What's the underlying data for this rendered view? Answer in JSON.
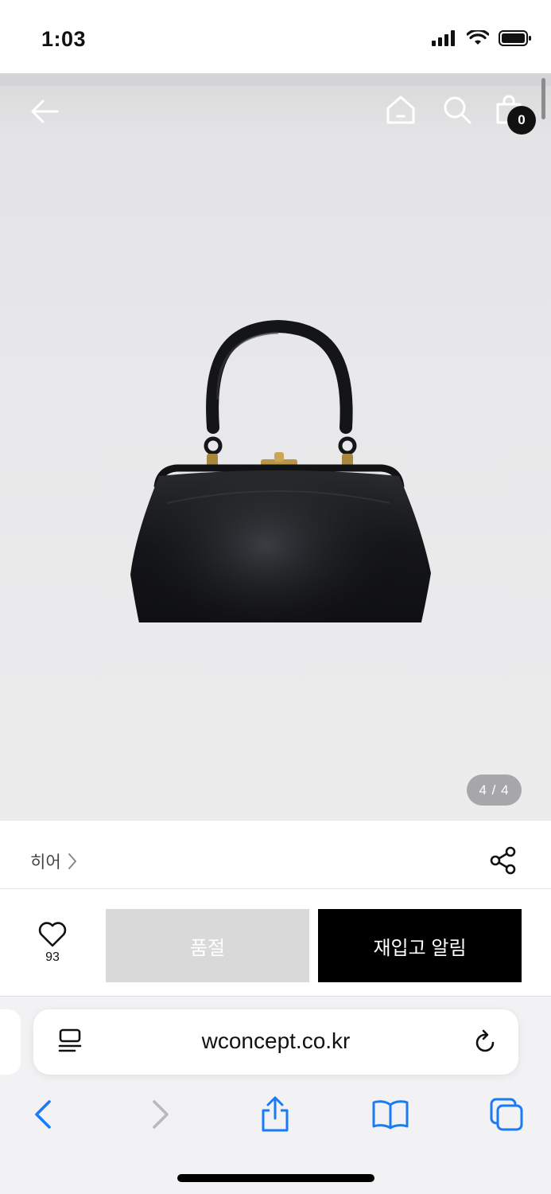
{
  "status_bar": {
    "time": "1:03"
  },
  "product": {
    "image_counter": "4 / 4",
    "cart_count": "0",
    "brand": "히어",
    "like_count": "93",
    "soldout_label": "품절",
    "restock_label": "재입고 알림"
  },
  "browser": {
    "url": "wconcept.co.kr"
  },
  "icons": {
    "back": "arrow-left-icon",
    "home": "home-icon",
    "search": "search-icon",
    "cart": "shopping-bag-icon",
    "share": "share-icon",
    "wish": "heart-icon",
    "reader": "reader-icon",
    "reload": "reload-icon",
    "nav_back": "chevron-left-icon",
    "nav_forward": "chevron-right-icon",
    "share_sheet": "share-sheet-icon",
    "bookmarks": "book-icon",
    "tabs": "tabs-icon"
  },
  "colors": {
    "accent_blue": "#1a7cf5",
    "button_black": "#000000",
    "button_disabled": "#d9d9d9"
  }
}
